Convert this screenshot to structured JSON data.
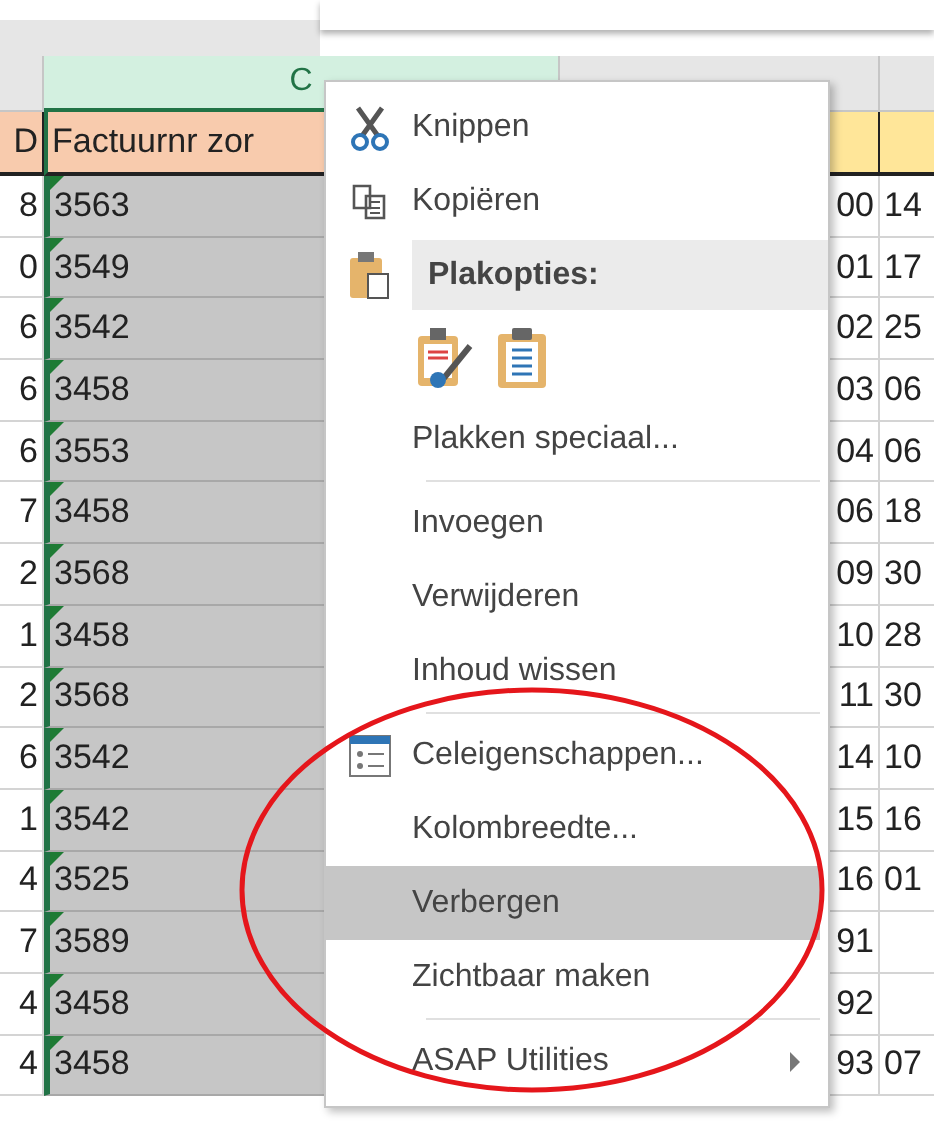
{
  "sheet": {
    "columns": [
      {
        "selected": false
      },
      {
        "label": "C",
        "selected": true
      },
      {
        "selected": false
      },
      {
        "selected": false
      }
    ],
    "header": [
      "D",
      "Factuurnr zor"
    ],
    "rows": [
      {
        "cells": [
          "8",
          "3563",
          "00",
          "14"
        ],
        "flagged": true
      },
      {
        "cells": [
          "0",
          "3549",
          "01",
          "17"
        ],
        "flagged": true
      },
      {
        "cells": [
          "6",
          "3542",
          "02",
          "25"
        ],
        "flagged": true
      },
      {
        "cells": [
          "6",
          "3458",
          "03",
          "06"
        ],
        "flagged": true
      },
      {
        "cells": [
          "6",
          "3553",
          "04",
          "06"
        ],
        "flagged": true
      },
      {
        "cells": [
          "7",
          "3458",
          "06",
          "18"
        ],
        "flagged": true
      },
      {
        "cells": [
          "2",
          "3568",
          "09",
          "30"
        ],
        "flagged": true
      },
      {
        "cells": [
          "1",
          "3458",
          "10",
          "28"
        ],
        "flagged": true
      },
      {
        "cells": [
          "2",
          "3568",
          "11",
          "30"
        ],
        "flagged": true
      },
      {
        "cells": [
          "6",
          "3542",
          "14",
          "10"
        ],
        "flagged": true
      },
      {
        "cells": [
          "1",
          "3542",
          "15",
          "16"
        ],
        "flagged": true
      },
      {
        "cells": [
          "4",
          "3525",
          "16",
          "01"
        ],
        "flagged": true
      },
      {
        "cells": [
          "7",
          "3589",
          "91"
        ],
        "flagged": true
      },
      {
        "cells": [
          "4",
          "3458",
          "92"
        ],
        "flagged": true
      },
      {
        "cells": [
          "4",
          "3458",
          "93",
          "07"
        ],
        "flagged": true
      }
    ]
  },
  "context_menu": {
    "items": [
      {
        "kind": "cut",
        "label": "Knippen",
        "selected": false
      },
      {
        "kind": "copy",
        "label": "Kopiëren",
        "selected": false
      },
      {
        "kind": "paste_header",
        "label": "Plakopties:"
      },
      {
        "kind": "paste_buttons"
      },
      {
        "kind": "command",
        "label": "Plakken speciaal...",
        "selected": false
      },
      {
        "kind": "separator"
      },
      {
        "kind": "command",
        "label": "Invoegen",
        "selected": false
      },
      {
        "kind": "command",
        "label": "Verwijderen",
        "selected": false
      },
      {
        "kind": "command",
        "label": "Inhoud wissen",
        "selected": false
      },
      {
        "kind": "separator"
      },
      {
        "kind": "cell_format",
        "label": "Celeigenschappen...",
        "selected": false
      },
      {
        "kind": "command",
        "label": "Kolombreedte...",
        "selected": false
      },
      {
        "kind": "command",
        "label": "Verbergen",
        "selected": true
      },
      {
        "kind": "command",
        "label": "Zichtbaar maken",
        "selected": false
      },
      {
        "kind": "separator"
      },
      {
        "kind": "submenu",
        "label": "ASAP Utilities",
        "selected": false
      }
    ]
  }
}
